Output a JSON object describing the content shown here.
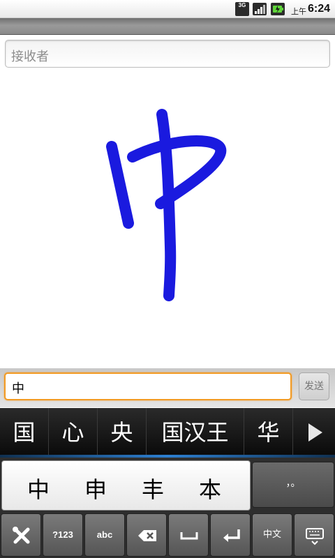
{
  "status_bar": {
    "network_label": "3G",
    "time_prefix": "上午",
    "time": "6:24"
  },
  "recipient": {
    "placeholder": "接收者"
  },
  "canvas": {
    "ink_color": "#1a1adf",
    "stroke_character": "中"
  },
  "compose": {
    "message_value": "中",
    "send_label": "发送",
    "focus_color": "#f29b24"
  },
  "candidate_bar": {
    "items": [
      "国",
      "心",
      "央",
      "国汉王",
      "华"
    ],
    "more_icon": "play-arrow-icon"
  },
  "keyboard": {
    "handwriting_candidates": [
      "中",
      "申",
      "丰",
      "本"
    ],
    "punctuation_label": "，。",
    "function_keys": {
      "settings_icon": "tools-icon",
      "numbers_label": "?123",
      "abc_label": "abc",
      "delete_icon": "backspace-icon",
      "space_icon": "space-icon",
      "enter_icon": "enter-icon",
      "chinese_label": "中文",
      "hide_icon": "keyboard-hide-icon"
    }
  }
}
